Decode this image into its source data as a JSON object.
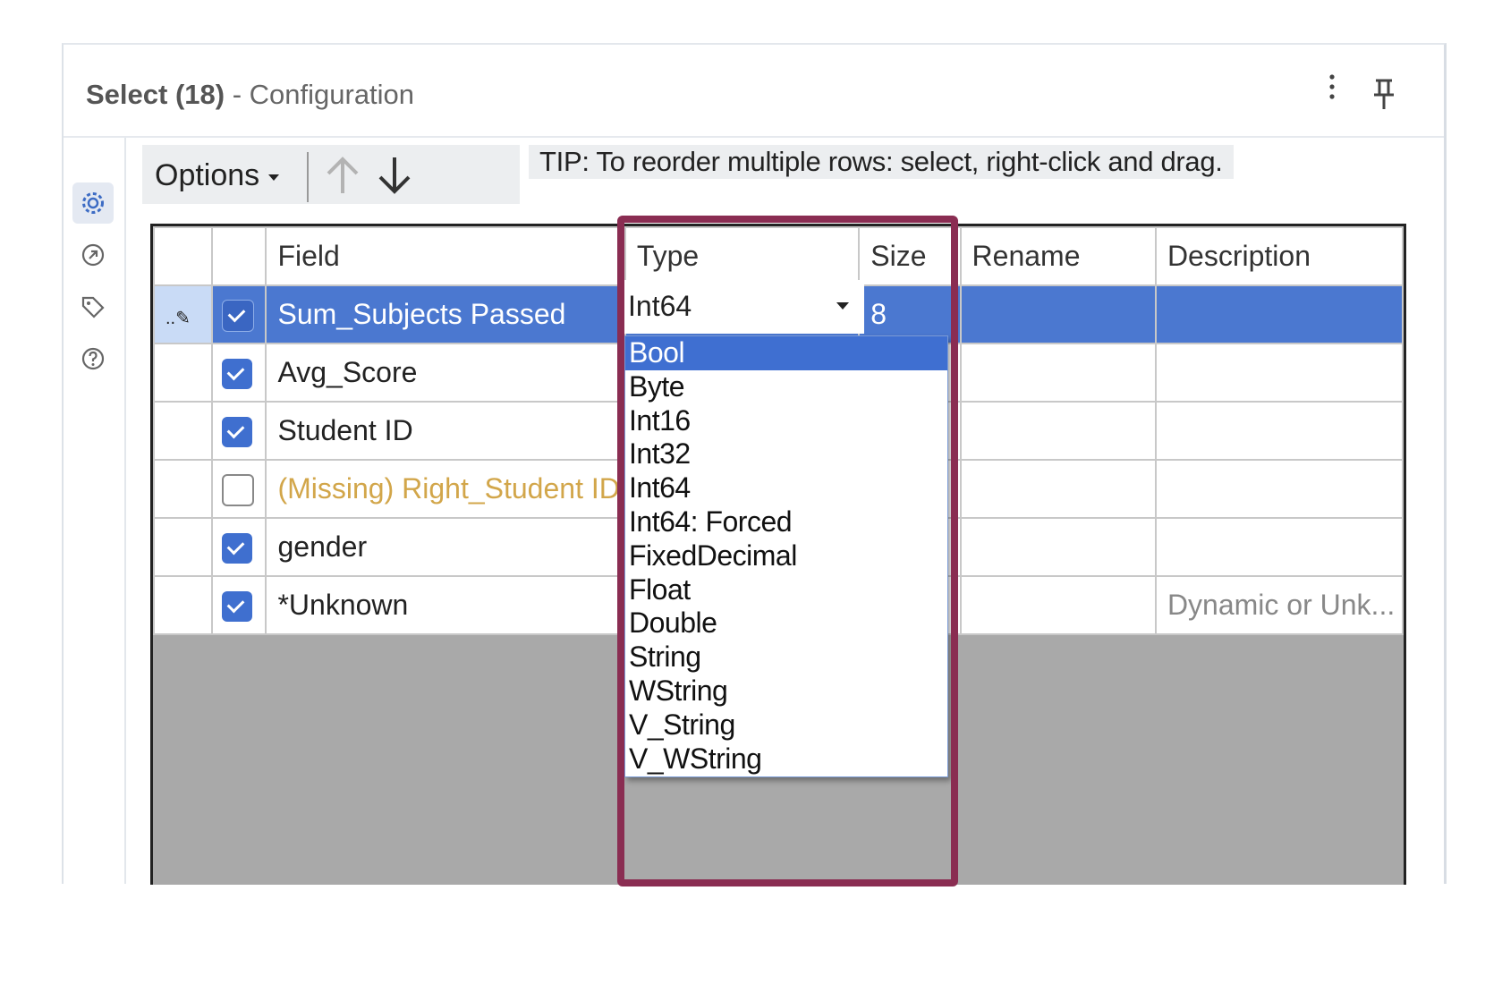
{
  "header": {
    "tool_name": "Select (18)",
    "subtitle": "- Configuration",
    "more_icon": "kebab-vertical-icon",
    "pin_icon": "pin-icon"
  },
  "leftbar": {
    "items": [
      {
        "name": "gear-icon",
        "active": true
      },
      {
        "name": "connection-icon",
        "active": false
      },
      {
        "name": "tag-icon",
        "active": false
      },
      {
        "name": "help-icon",
        "active": false
      }
    ]
  },
  "toolbar": {
    "options_label": "Options",
    "tip": "TIP: To reorder multiple rows: select, right-click and drag."
  },
  "grid": {
    "columns": [
      "",
      "",
      "Field",
      "Type",
      "Size",
      "Rename",
      "Description"
    ],
    "rows": [
      {
        "checked": true,
        "field": "Sum_Subjects Passed",
        "type": "Int64",
        "size": "8",
        "rename": "",
        "description": "",
        "selected": true
      },
      {
        "checked": true,
        "field": "Avg_Score",
        "type": "",
        "size": "",
        "rename": "",
        "description": ""
      },
      {
        "checked": true,
        "field": "Student ID",
        "type": "",
        "size": "",
        "rename": "",
        "description": ""
      },
      {
        "checked": false,
        "field": "(Missing) Right_Student ID",
        "type": "",
        "size": "",
        "rename": "",
        "description": "",
        "missing": true
      },
      {
        "checked": true,
        "field": "gender",
        "type": "",
        "size": "",
        "rename": "",
        "description": ""
      },
      {
        "checked": true,
        "field": "*Unknown",
        "type": "",
        "size": "",
        "rename": "",
        "description": "Dynamic or Unk..."
      }
    ]
  },
  "type_dropdown": {
    "selected_value": "Int64",
    "highlighted": "Bool",
    "options": [
      "Bool",
      "Byte",
      "Int16",
      "Int32",
      "Int64",
      "Int64: Forced",
      "FixedDecimal",
      "Float",
      "Double",
      "String",
      "WString",
      "V_String",
      "V_WString"
    ]
  },
  "colors": {
    "selection": "#4b78d0",
    "highlight_border": "#8a2d52",
    "missing_text": "#d2a64a"
  }
}
